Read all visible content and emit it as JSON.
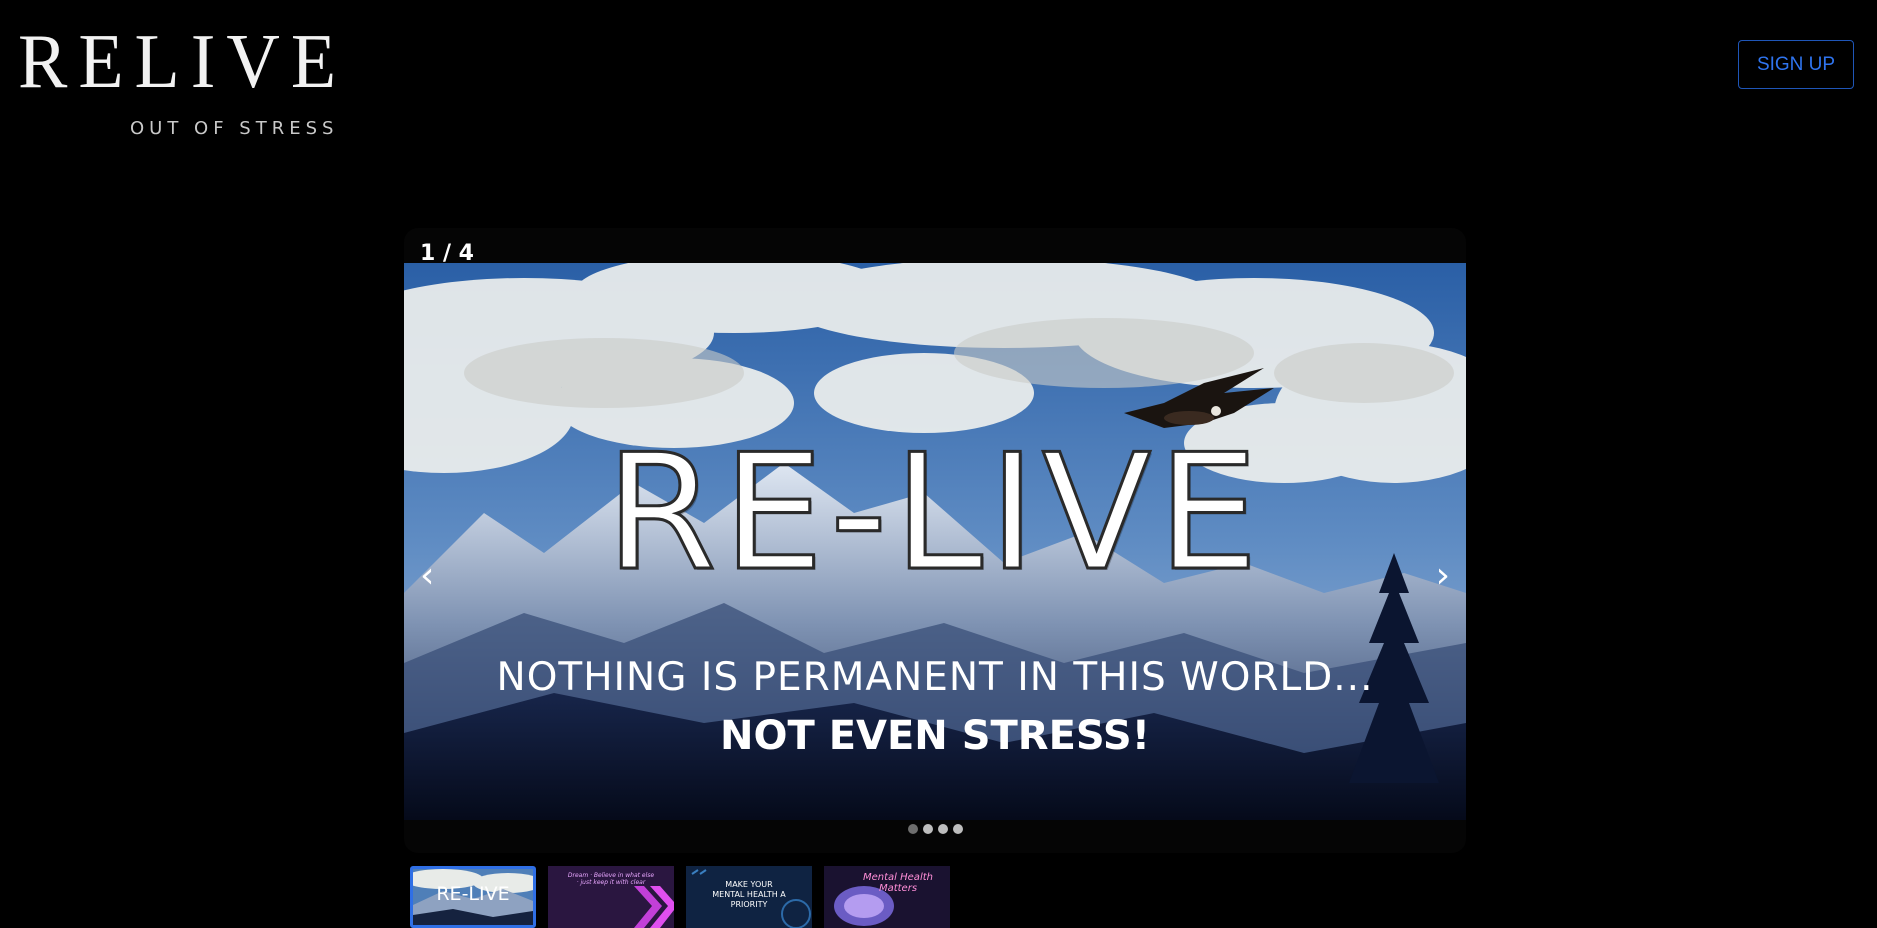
{
  "logo": {
    "title": "RELIVE",
    "subtitle": "OUT OF STRESS"
  },
  "header": {
    "signup_label": "SIGN UP"
  },
  "carousel": {
    "counter": "1 / 4",
    "current": 1,
    "total": 4,
    "slide": {
      "title": "RE-LIVE",
      "line1": "NOTHING IS PERMANENT IN THIS WORLD...",
      "line2": "NOT EVEN STRESS!"
    },
    "prev_icon": "‹",
    "next_icon": "›",
    "dots": [
      {
        "active": true
      },
      {
        "active": false
      },
      {
        "active": false
      },
      {
        "active": false
      }
    ]
  },
  "thumbnails": [
    {
      "text": "RE-LIVE",
      "active": true
    },
    {
      "text": "Dream · Believe in what else · just keep it with clear",
      "active": false
    },
    {
      "text": "MAKE YOUR MENTAL HEALTH A PRIORITY",
      "active": false
    },
    {
      "text": "Mental Health Matters",
      "active": false
    }
  ],
  "colors": {
    "accent": "#2f74ef",
    "background": "#000000",
    "thumb_active_border": "#2f6fe6"
  }
}
